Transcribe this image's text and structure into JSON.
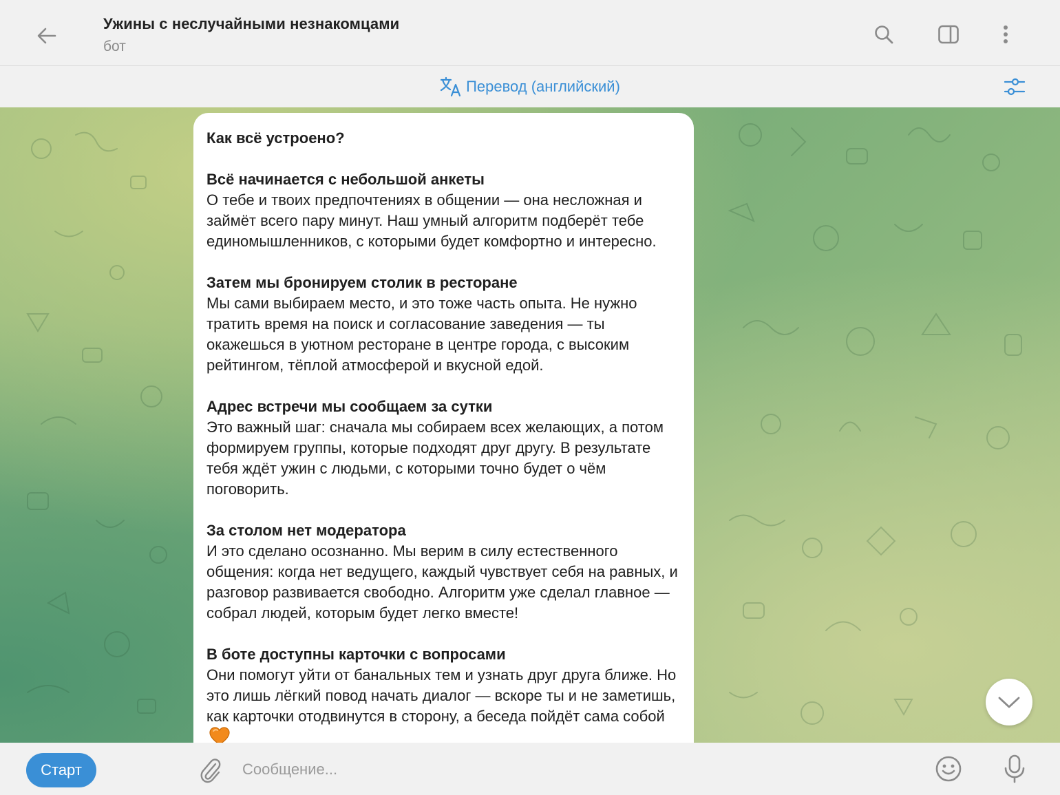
{
  "header": {
    "title": "Ужины с неслучайными незнакомцами",
    "subtitle": "бот",
    "icons": [
      "back-arrow-icon",
      "search-icon",
      "sidebar-toggle-icon",
      "more-vertical-icon"
    ]
  },
  "translate_bar": {
    "label": "Перевод (английский)",
    "icon": "translate-icon",
    "settings_icon": "sliders-icon",
    "color": "#3a8fd6"
  },
  "message": {
    "intro": "Как всё устроено?",
    "sections": [
      {
        "heading": "Всё начинается с небольшой анкеты",
        "body": "О тебе и твоих предпочтениях в общении — она несложная и займёт всего пару минут. Наш умный алгоритм подберёт тебе единомышленников, с которыми будет комфортно и интересно."
      },
      {
        "heading": "Затем мы бронируем столик в ресторане",
        "body": "Мы сами выбираем место, и это тоже часть опыта. Не нужно тратить время на поиск и согласование заведения — ты окажешься в уютном ресторане в центре города, с высоким рейтингом, тёплой атмосферой и вкусной едой."
      },
      {
        "heading": "Адрес встречи мы сообщаем за сутки",
        "body": "Это важный шаг: сначала мы собираем всех желающих, а потом формируем группы, которые подходят друг другу. В результате тебя ждёт ужин с людьми, с которыми точно будет о чём поговорить."
      },
      {
        "heading": "За столом нет модератора",
        "body": "И это сделано осознанно. Мы верим в силу естественного общения: когда нет ведущего, каждый чувствует себя на равных, и разговор развивается свободно. Алгоритм уже сделал главное — собрал людей, которым будет легко вместе!"
      },
      {
        "heading": "В боте доступны карточки с вопросами",
        "body": "Они помогут уйти от банальных тем и узнать друг друга ближе. Но это лишь лёгкий повод начать диалог — вскоре ты и не заметишь, как карточки отодвинутся в сторону, а беседа пойдёт сама собой"
      }
    ],
    "emoji": "orange-heart-icon"
  },
  "composer": {
    "start_label": "Старт",
    "placeholder": "Сообщение...",
    "value": "",
    "accent": "#3a8fd6",
    "icons": [
      "paperclip-icon",
      "emoji-icon",
      "microphone-icon"
    ]
  },
  "scroll_down_icon": "chevron-down-icon"
}
